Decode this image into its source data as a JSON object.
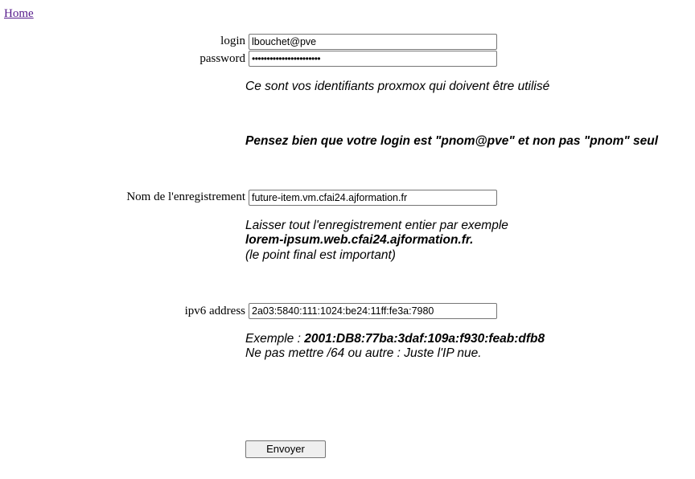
{
  "nav": {
    "home_link": "Home"
  },
  "form": {
    "login": {
      "label": "login",
      "value": "lbouchet@pve"
    },
    "password": {
      "label": "password",
      "value": "•••••••••••••••••••••••"
    },
    "credentials_note": "Ce sont vos identifiants proxmox qui doivent être utilisé",
    "login_warning": "Pensez bien que votre login est \"pnom@pve\" et non pas \"pnom\" seul",
    "record_name": {
      "label": "Nom de l'enregistrement",
      "value": "future-item.vm.cfai24.ajformation.fr"
    },
    "record_note": {
      "line1": "Laisser tout l'enregistrement entier par exemple",
      "line2": "lorem-ipsum.web.cfai24.ajformation.fr.",
      "line3": "(le point final est important)"
    },
    "ipv6": {
      "label": "ipv6 address",
      "value": "2a03:5840:111:1024:be24:11ff:fe3a:7980"
    },
    "ipv6_note": {
      "prefix": "Exemple : ",
      "example": "2001:DB8:77ba:3daf:109a:f930:feab:dfb8",
      "line2": "Ne pas mettre /64 ou autre : Juste l'IP nue."
    },
    "submit_label": "Envoyer"
  }
}
